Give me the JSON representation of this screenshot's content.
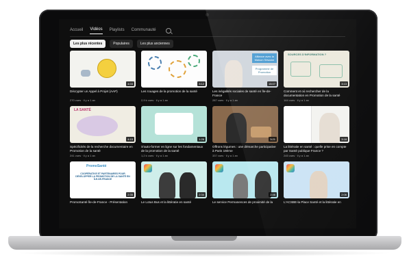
{
  "nav": {
    "tabs": [
      "Accueil",
      "Vidéos",
      "Playlists",
      "Communauté"
    ],
    "active_tab": "Vidéos"
  },
  "filters": {
    "chips": [
      "Les plus récentes",
      "Populaires",
      "Les plus anciennes"
    ],
    "active": "Les plus récentes"
  },
  "videos": [
    {
      "title": "Décrypter un Appel à Projet (AAP)",
      "meta": "270 vues · il y a 1 an",
      "duration": "4:03"
    },
    {
      "title": "Les rouages de la promotion de la santé",
      "meta": "2,9 k vues · il y a 1 an",
      "duration": "3:12"
    },
    {
      "title": "Les inégalités sociales de santé en Île-de-France",
      "meta": "287 vues · il y a 1 an",
      "duration": "15:07",
      "overlay_text": "Alliance avec la Maison Sésame",
      "overlay_text_2": "Programme de Promotion"
    },
    {
      "title": "Comment et où rechercher de la documentation en Promotion de la santé",
      "meta": "144 vues · il y a 1 an",
      "duration": "3:13",
      "overlay_text": "SOURCES D'INFORMATION ?"
    },
    {
      "title": "Spécificités de la recherche documentaire en Promotion de la santé",
      "meta": "241 vues · il y a 1 an",
      "duration": "4:15",
      "overlay_text": "LA SANTÉ"
    },
    {
      "title": "S'auto-former en ligne sur les fondamentaux de la promotion de la santé",
      "meta": "1,2 k vues · il y a 1 an",
      "duration": "1:26"
    },
    {
      "title": "Offrons légumes : une démarche participative à Paris 19ème",
      "meta": "337 vues · il y a 1 an",
      "duration": "3:21"
    },
    {
      "title": "La littératie en santé : quelle prise en compte par Santé publique France ?",
      "meta": "245 vues · il y a 1 an",
      "duration": "3:18"
    },
    {
      "title": "PromoSanté Île-de-France - Présentation",
      "meta": "",
      "duration": "2:35",
      "overlay_text": "PromoSanté",
      "overlay_text_2": "COOPÉRATIVE ET PARTENAIRES POUR DÉVELOPPER LA PROMOTION DE LA SANTÉ EN ÎLE-DE-FRANCE"
    },
    {
      "title": "Le Lotus Bus et la littératie en santé",
      "meta": "",
      "duration": "2:34"
    },
    {
      "title": "Le service Permanences de proximité de la",
      "meta": "",
      "duration": "2:46"
    },
    {
      "title": "L'ACSBE-la Place Santé et la littératie en",
      "meta": "",
      "duration": "2:06"
    }
  ]
}
